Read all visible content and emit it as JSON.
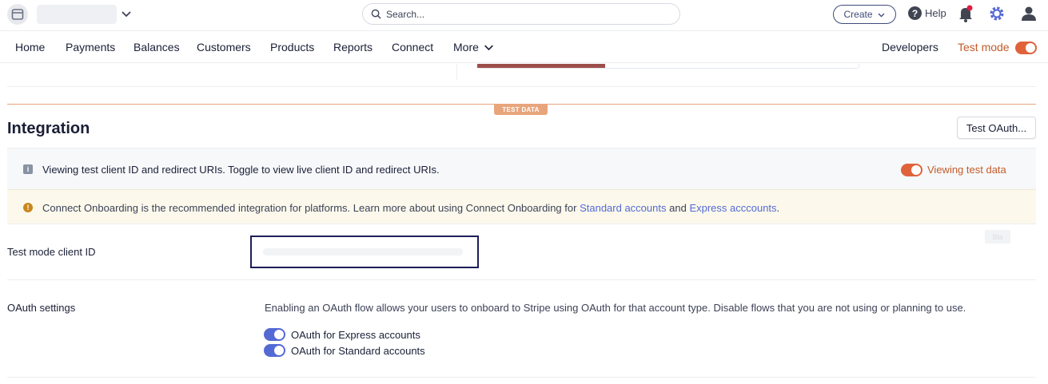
{
  "topbar": {
    "search_placeholder": "Search...",
    "create_label": "Create",
    "help_label": "Help",
    "icons": [
      "store-icon",
      "chevron-down-icon",
      "search-icon",
      "help-icon",
      "bell-icon",
      "gear-icon",
      "user-icon"
    ]
  },
  "nav": {
    "items": [
      "Home",
      "Payments",
      "Balances",
      "Customers",
      "Products",
      "Reports",
      "Connect",
      "More"
    ],
    "developers": "Developers",
    "test_mode_label": "Test mode",
    "test_mode_on": true
  },
  "test_data_badge": "TEST DATA",
  "integration": {
    "title": "Integration",
    "test_oauth_button": "Test OAuth...",
    "info_banner_text": "Viewing test client ID and redirect URIs. Toggle to view live client ID and redirect URIs.",
    "viewing_toggle_label": "Viewing test data",
    "viewing_toggle_on": true,
    "warning": {
      "prefix": "Connect Onboarding is the recommended integration for platforms. Learn more about using Connect Onboarding for",
      "link_standard": "Standard accounts",
      "and": "and",
      "link_express": "Express acccounts",
      "suffix": "."
    },
    "client_id_label": "Test mode client ID",
    "copy_chip": "Bla",
    "oauth": {
      "label": "OAuth settings",
      "description": "Enabling an OAuth flow allows your users to onboard to Stripe using OAuth for that account type. Disable flows that you are not using or planning to use.",
      "express_label": "OAuth for Express accounts",
      "standard_label": "OAuth for Standard accounts",
      "express_on": true,
      "standard_on": true
    }
  },
  "colors": {
    "accent_orange": "#e0623a",
    "test_badge": "#e8a57c",
    "link_blue": "#5469d4",
    "warn_bg": "#fcf9ec"
  }
}
